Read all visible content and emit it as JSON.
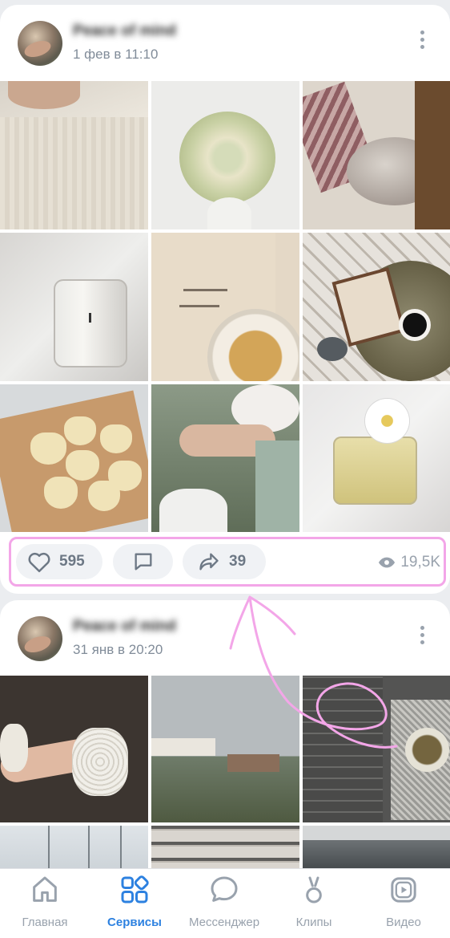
{
  "posts": [
    {
      "author": "Peace of mind",
      "date": "1 фев в 11:10",
      "likes": "595",
      "shares": "39",
      "views": "19,5K",
      "photos": [
        "photo-linen",
        "photo-roses",
        "photo-cat",
        "photo-candle",
        "photo-tote-bag",
        "photo-book-tray",
        "photo-cookies",
        "photo-flowers-hand",
        "photo-perfume"
      ]
    },
    {
      "author": "Peace of mind",
      "date": "31 янв в 20:20",
      "photos": [
        "photo-watch-wrist",
        "photo-seaside-cliffs",
        "photo-stove-tea",
        "photo-masts",
        "photo-sweaters",
        "photo-mountains"
      ]
    }
  ],
  "tabbar": {
    "items": [
      {
        "label": "Главная",
        "icon": "home-icon"
      },
      {
        "label": "Сервисы",
        "icon": "services-icon"
      },
      {
        "label": "Мессенджер",
        "icon": "messenger-icon"
      },
      {
        "label": "Клипы",
        "icon": "clips-icon"
      },
      {
        "label": "Видео",
        "icon": "video-icon"
      }
    ],
    "active": "Сервисы"
  },
  "colors": {
    "accent": "#2d81e0",
    "highlight": "#f3a6e8",
    "secondary_text": "#818c99"
  }
}
